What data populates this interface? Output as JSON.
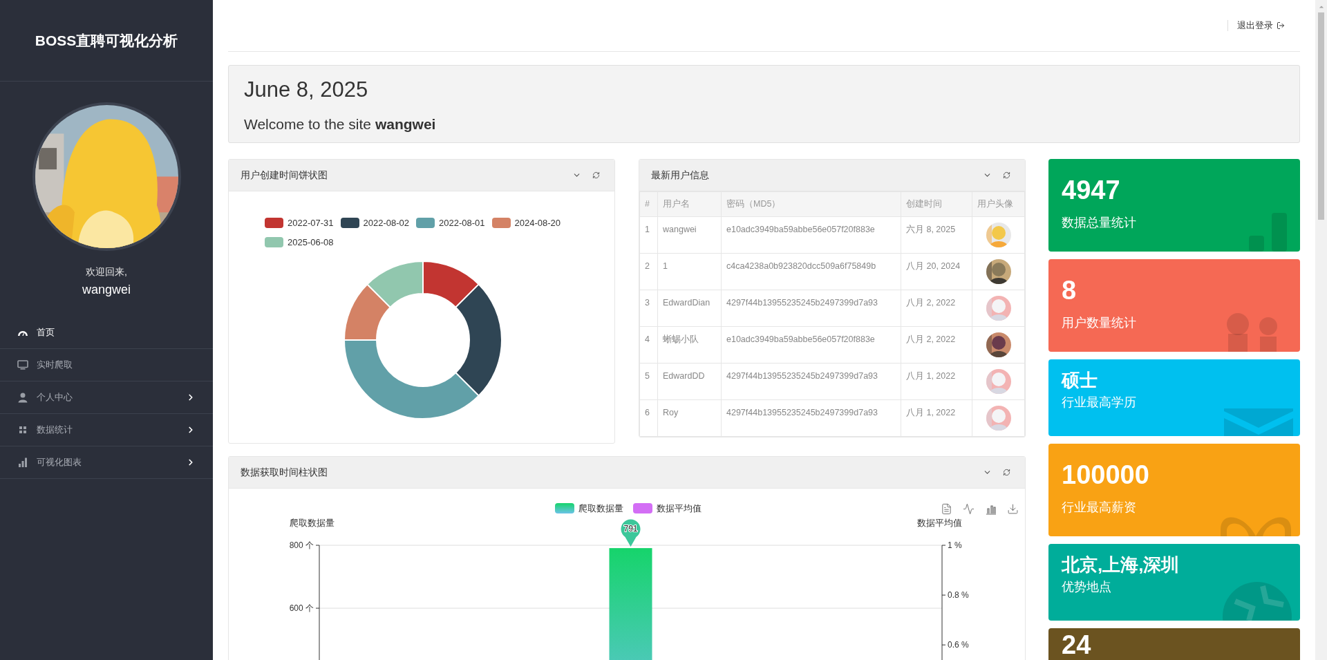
{
  "sidebar": {
    "title": "BOSS直聘可视化分析",
    "greeting": "欢迎回来,",
    "username": "wangwei",
    "items": [
      {
        "label": "首页",
        "selected": true,
        "has_submenu": false
      },
      {
        "label": "实时爬取",
        "selected": false,
        "has_submenu": false
      },
      {
        "label": "个人中心",
        "selected": false,
        "has_submenu": true
      },
      {
        "label": "数据统计",
        "selected": false,
        "has_submenu": true
      },
      {
        "label": "可视化图表",
        "selected": false,
        "has_submenu": true
      }
    ]
  },
  "header": {
    "logout": "退出登录"
  },
  "welcome": {
    "date": "June 8, 2025",
    "message": "Welcome to the site **wangwei**"
  },
  "pie_panel": {
    "title": "用户创建时间饼状图",
    "chart_data": {
      "type": "donut",
      "categories": [
        "2022-07-31",
        "2022-08-02",
        "2022-08-01",
        "2024-08-20",
        "2025-06-08"
      ],
      "values": [
        12.5,
        25,
        37.5,
        12.5,
        12.5
      ],
      "colors": [
        "#c23531",
        "#2f4554",
        "#61a0a8",
        "#d48265",
        "#91c7ae"
      ]
    }
  },
  "table_panel": {
    "title": "最新用户信息",
    "columns": [
      "#",
      "用户名",
      "密码（MD5）",
      "创建时间",
      "用户头像"
    ],
    "rows": [
      {
        "cells": [
          "1",
          "wangwei",
          "e10adc3949ba59abbe56e057f20f883e",
          "六月 8, 2025"
        ]
      },
      {
        "cells": [
          "2",
          "1",
          "c4ca4238a0b923820dcc509a6f75849b",
          "八月 20, 2024"
        ]
      },
      {
        "cells": [
          "3",
          "EdwardDian",
          "4297f44b13955235245b2497399d7a93",
          "八月 2, 2022"
        ]
      },
      {
        "cells": [
          "4",
          "蜥蜴小队",
          "e10adc3949ba59abbe56e057f20f883e",
          "八月 2, 2022"
        ]
      },
      {
        "cells": [
          "5",
          "EdwardDD",
          "4297f44b13955235245b2497399d7a93",
          "八月 1, 2022"
        ]
      },
      {
        "cells": [
          "6",
          "Roy",
          "4297f44b13955235245b2497399d7a93",
          "八月 1, 2022"
        ]
      }
    ]
  },
  "bar_panel": {
    "title": "数据获取时间柱状图",
    "chart_data": {
      "type": "bar",
      "ylabel": "爬取数据量",
      "y2label": "数据平均值",
      "series": [
        {
          "name": "爬取数据量",
          "color": "#16d46b",
          "values": [
            791
          ]
        },
        {
          "name": "数据平均值",
          "color": "#d36ef5",
          "values": [
            null
          ]
        }
      ],
      "ylim": [
        420,
        800
      ],
      "y2lim": [
        0.52,
        1
      ],
      "yticks": [
        {
          "value": 600,
          "label": "600 个"
        },
        {
          "value": 800,
          "label": "800 个"
        }
      ],
      "y2ticks": [
        {
          "value": 0.6,
          "label": "0.6 %"
        },
        {
          "value": 0.8,
          "label": "0.8 %"
        },
        {
          "value": 1,
          "label": "1 %"
        }
      ],
      "data_labels": true
    }
  },
  "cards": [
    {
      "value": "4947",
      "label": "数据总量统计",
      "color": "#00a65a"
    },
    {
      "value": "8",
      "label": "用户数量统计",
      "color": "#f56954"
    },
    {
      "value": "硕士",
      "label": "行业最高学历",
      "color": "#00c0ef"
    },
    {
      "value": "100000",
      "label": "行业最高薪资",
      "color": "#f9a214"
    },
    {
      "value": "北京,上海,深圳",
      "label": "优势地点",
      "color": "#00ad9a"
    },
    {
      "value": "24",
      "color": "#6b5320"
    }
  ]
}
